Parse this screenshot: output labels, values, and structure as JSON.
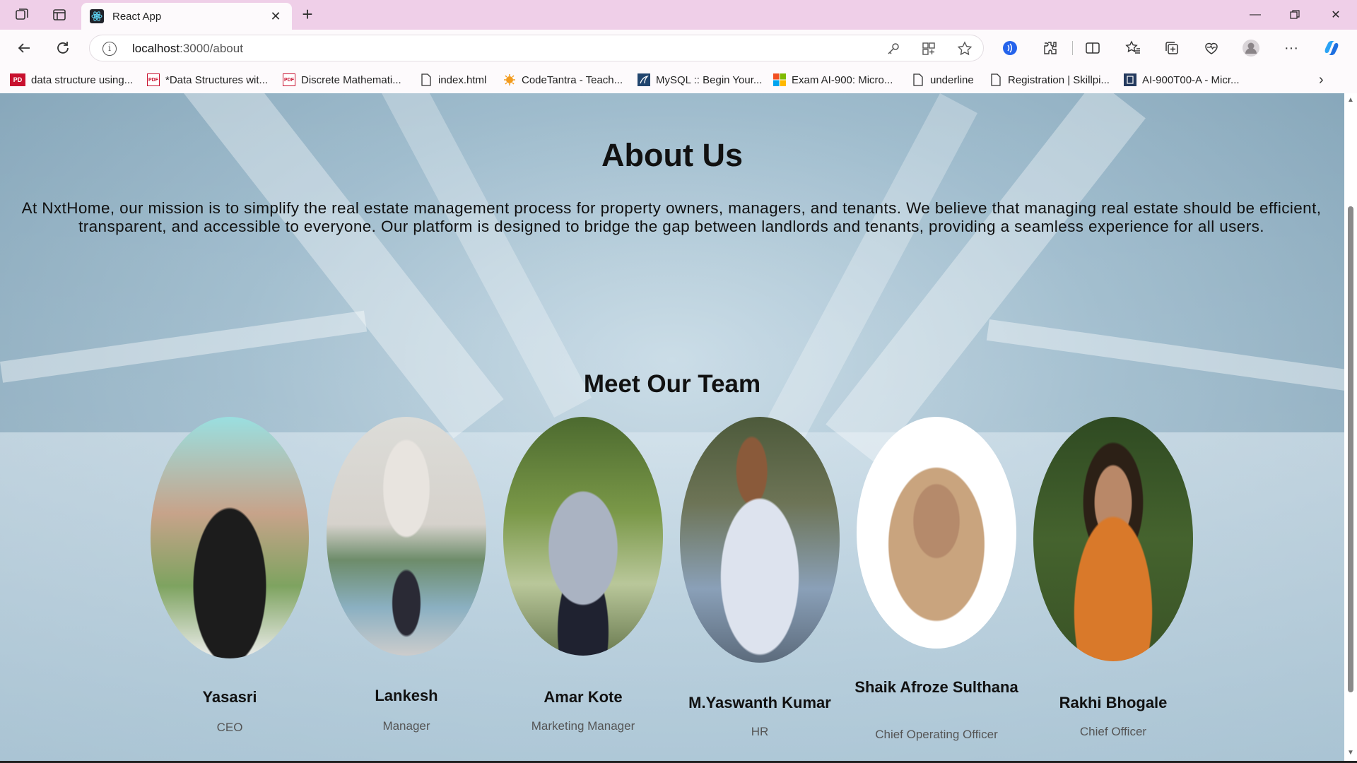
{
  "browser": {
    "tab_title": "React App",
    "url_host": "localhost",
    "url_rest": ":3000/about",
    "bookmarks": [
      {
        "label": "data structure using...",
        "icon": "pdf-icon"
      },
      {
        "label": "*Data Structures wit...",
        "icon": "pdf-icon"
      },
      {
        "label": "Discrete Mathemati...",
        "icon": "pdf-icon"
      },
      {
        "label": "index.html",
        "icon": "file-icon"
      },
      {
        "label": "CodeTantra - Teach...",
        "icon": "codetantra-icon"
      },
      {
        "label": "MySQL :: Begin Your...",
        "icon": "mysql-icon"
      },
      {
        "label": "Exam AI-900: Micro...",
        "icon": "microsoft-icon"
      },
      {
        "label": "underline",
        "icon": "file-icon"
      },
      {
        "label": "Registration | Skillpi...",
        "icon": "file-icon"
      },
      {
        "label": "AI-900T00-A - Micr...",
        "icon": "book-icon"
      }
    ]
  },
  "about": {
    "title": "About Us",
    "mission": "At NxtHome, our mission is to simplify the real estate management process for property owners, managers, and tenants. We believe that managing real estate should be efficient, transparent, and accessible to everyone. Our platform is designed to bridge the gap between landlords and tenants, providing a seamless experience for all users."
  },
  "team": {
    "title": "Meet Our Team",
    "members": [
      {
        "name": "Yasasri",
        "role": "CEO"
      },
      {
        "name": "Lankesh",
        "role": "Manager"
      },
      {
        "name": "Amar Kote",
        "role": "Marketing Manager"
      },
      {
        "name": "M.Yaswanth Kumar",
        "role": "HR"
      },
      {
        "name": "Shaik Afroze Sulthana",
        "role": "Chief Operating Officer"
      },
      {
        "name": "Rakhi Bhogale",
        "role": "Chief Officer"
      }
    ]
  },
  "colors": {
    "tab_strip": "#efcfe8",
    "heading": "#111111",
    "role_text": "#555555"
  }
}
